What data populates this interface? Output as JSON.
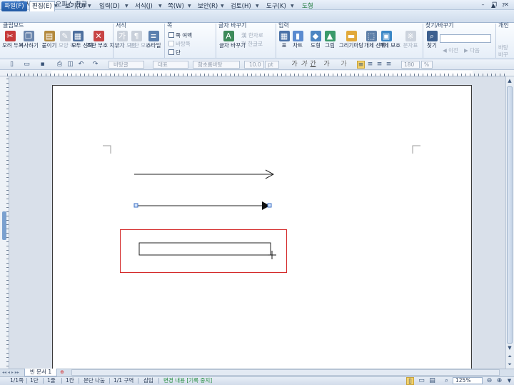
{
  "window": {
    "title": "빈 문서 1 - 한컴오피스 한글",
    "icon": "hwp-app-icon",
    "controls": {
      "minimize": "–",
      "restore": "❐",
      "close": "✕"
    }
  },
  "menubar": {
    "file_label": "파일(F)",
    "items": [
      "편집(E)",
      "보기(U)",
      "입력(D)",
      "서식(J)",
      "쪽(W)",
      "보안(R)",
      "검토(H)",
      "도구(K)",
      "도형"
    ]
  },
  "ribbon": {
    "groups": [
      "클립보드",
      "서식",
      "쪽",
      "글자 바꾸기",
      "입력",
      "찾기/바꾸기",
      "개인"
    ],
    "clipboard": [
      "오려 두기",
      "복사하기",
      "붙이기",
      "모양 복사",
      "모두 선택",
      "조판 부호 지우기"
    ],
    "format": [
      "글자 모양",
      "문단 모양",
      "스타일"
    ],
    "page": [
      "쪽 여백",
      "바탕쪽",
      "단"
    ],
    "charchange": [
      "글자 바꾸기",
      "한자로",
      "한글로"
    ],
    "insert": [
      "표",
      "차트",
      "도형",
      "그림",
      "그리기마당",
      "개체 선택",
      "개체 보호",
      "문자표"
    ],
    "find": [
      "찾기",
      "이전",
      "다음"
    ],
    "personal": "바탕 바꾸"
  },
  "toolbar": {
    "style": "바탕글",
    "font_kind": "대표",
    "font": "함초롬바탕",
    "size": "10.0",
    "unit": "pt",
    "bold": "가",
    "italic": "가",
    "underline": "간",
    "strike": "가",
    "spacing": "180",
    "percent": "%"
  },
  "document": {
    "tab_label": "빈 문서 1"
  },
  "status": {
    "page": "1/1쪽",
    "section": "1단",
    "line": "1줄",
    "col": "1칸",
    "break": "문단 나눔",
    "zone": "1/1 구역",
    "mode": "삽입",
    "track": "변경 내용 [기록 중지]",
    "zoom": "125%"
  },
  "colors": {
    "selection": "#d42a2a",
    "accent": "#2b67b5",
    "track": "#1f8a3a"
  }
}
